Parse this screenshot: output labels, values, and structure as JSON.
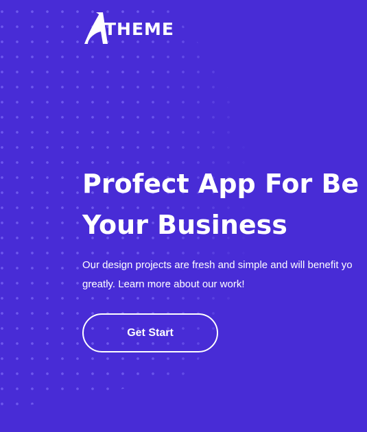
{
  "colors": {
    "background": "#482cd6",
    "text": "#ffffff",
    "dot_pattern": "#8c7dff"
  },
  "header": {
    "logo_text": "THEME",
    "logo_icon": "a-letter-mark-icon"
  },
  "hero": {
    "headline_line1": "Profect App For Be",
    "headline_line2": "Your Business",
    "description_line1": "Our design projects are fresh and simple and will benefit yo",
    "description_line2": "greatly. Learn more about our work!",
    "cta_label": "Get Start"
  }
}
